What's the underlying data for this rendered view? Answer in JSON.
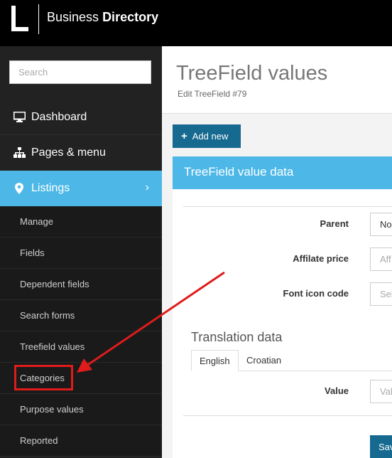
{
  "header": {
    "app_title_prefix": "Business",
    "app_title_bold": "Directory"
  },
  "sidebar": {
    "search_placeholder": "Search",
    "nav": [
      {
        "label": "Dashboard",
        "icon": "monitor-icon"
      },
      {
        "label": "Pages & menu",
        "icon": "sitemap-icon"
      },
      {
        "label": "Listings",
        "icon": "map-marker-icon",
        "active": true
      }
    ],
    "listings_sub": [
      {
        "label": "Manage"
      },
      {
        "label": "Fields"
      },
      {
        "label": "Dependent fields"
      },
      {
        "label": "Search forms"
      },
      {
        "label": "Treefield values"
      },
      {
        "label": "Categories"
      },
      {
        "label": "Purpose values"
      },
      {
        "label": "Reported"
      }
    ]
  },
  "main": {
    "title": "TreeField values",
    "subtitle": "Edit TreeField #79",
    "add_new_label": "Add new",
    "panel_title": "TreeField value data",
    "fields": [
      {
        "label": "Parent",
        "value": "No",
        "placeholder": ""
      },
      {
        "label": "Affilate price",
        "value": "",
        "placeholder": "Aff"
      },
      {
        "label": "Font icon code",
        "value": "",
        "placeholder": "Sel"
      }
    ],
    "translation_title": "Translation data",
    "tabs": [
      {
        "label": "English",
        "active": true
      },
      {
        "label": "Croatian",
        "active": false
      }
    ],
    "value_label": "Value",
    "value_placeholder": "Val",
    "save_label": "Save"
  },
  "colors": {
    "accent": "#4db8e8",
    "button": "#16698f",
    "sidebar": "#222222",
    "annotation": "#e01b1b"
  }
}
